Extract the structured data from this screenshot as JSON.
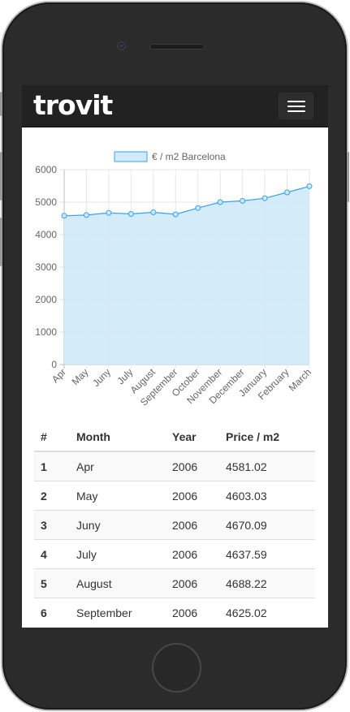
{
  "brand": {
    "name": "trovit"
  },
  "chart_data": {
    "type": "line",
    "legend": "€ / m2 Barcelona",
    "categories": [
      "Apr",
      "May",
      "Juny",
      "July",
      "August",
      "September",
      "October",
      "November",
      "December",
      "January",
      "February",
      "March"
    ],
    "values": [
      4581.02,
      4603.03,
      4670.09,
      4637.59,
      4688.22,
      4625.02,
      4820,
      5000,
      5040,
      5120,
      5300,
      5490
    ],
    "yticks": [
      "0",
      "1000",
      "2000",
      "3000",
      "4000",
      "5000",
      "6000"
    ],
    "ylim": [
      0,
      6000
    ],
    "area_fill": true,
    "grid": true,
    "legend_position": "top",
    "colors": {
      "line": "#36a2eb",
      "fill": "#d2eafa",
      "point_fill": "#cde7f9"
    }
  },
  "table": {
    "headers": [
      "#",
      "Month",
      "Year",
      "Price / m2"
    ],
    "rows": [
      [
        "1",
        "Apr",
        "2006",
        "4581.02"
      ],
      [
        "2",
        "May",
        "2006",
        "4603.03"
      ],
      [
        "3",
        "Juny",
        "2006",
        "4670.09"
      ],
      [
        "4",
        "July",
        "2006",
        "4637.59"
      ],
      [
        "5",
        "August",
        "2006",
        "4688.22"
      ],
      [
        "6",
        "September",
        "2006",
        "4625.02"
      ]
    ]
  }
}
